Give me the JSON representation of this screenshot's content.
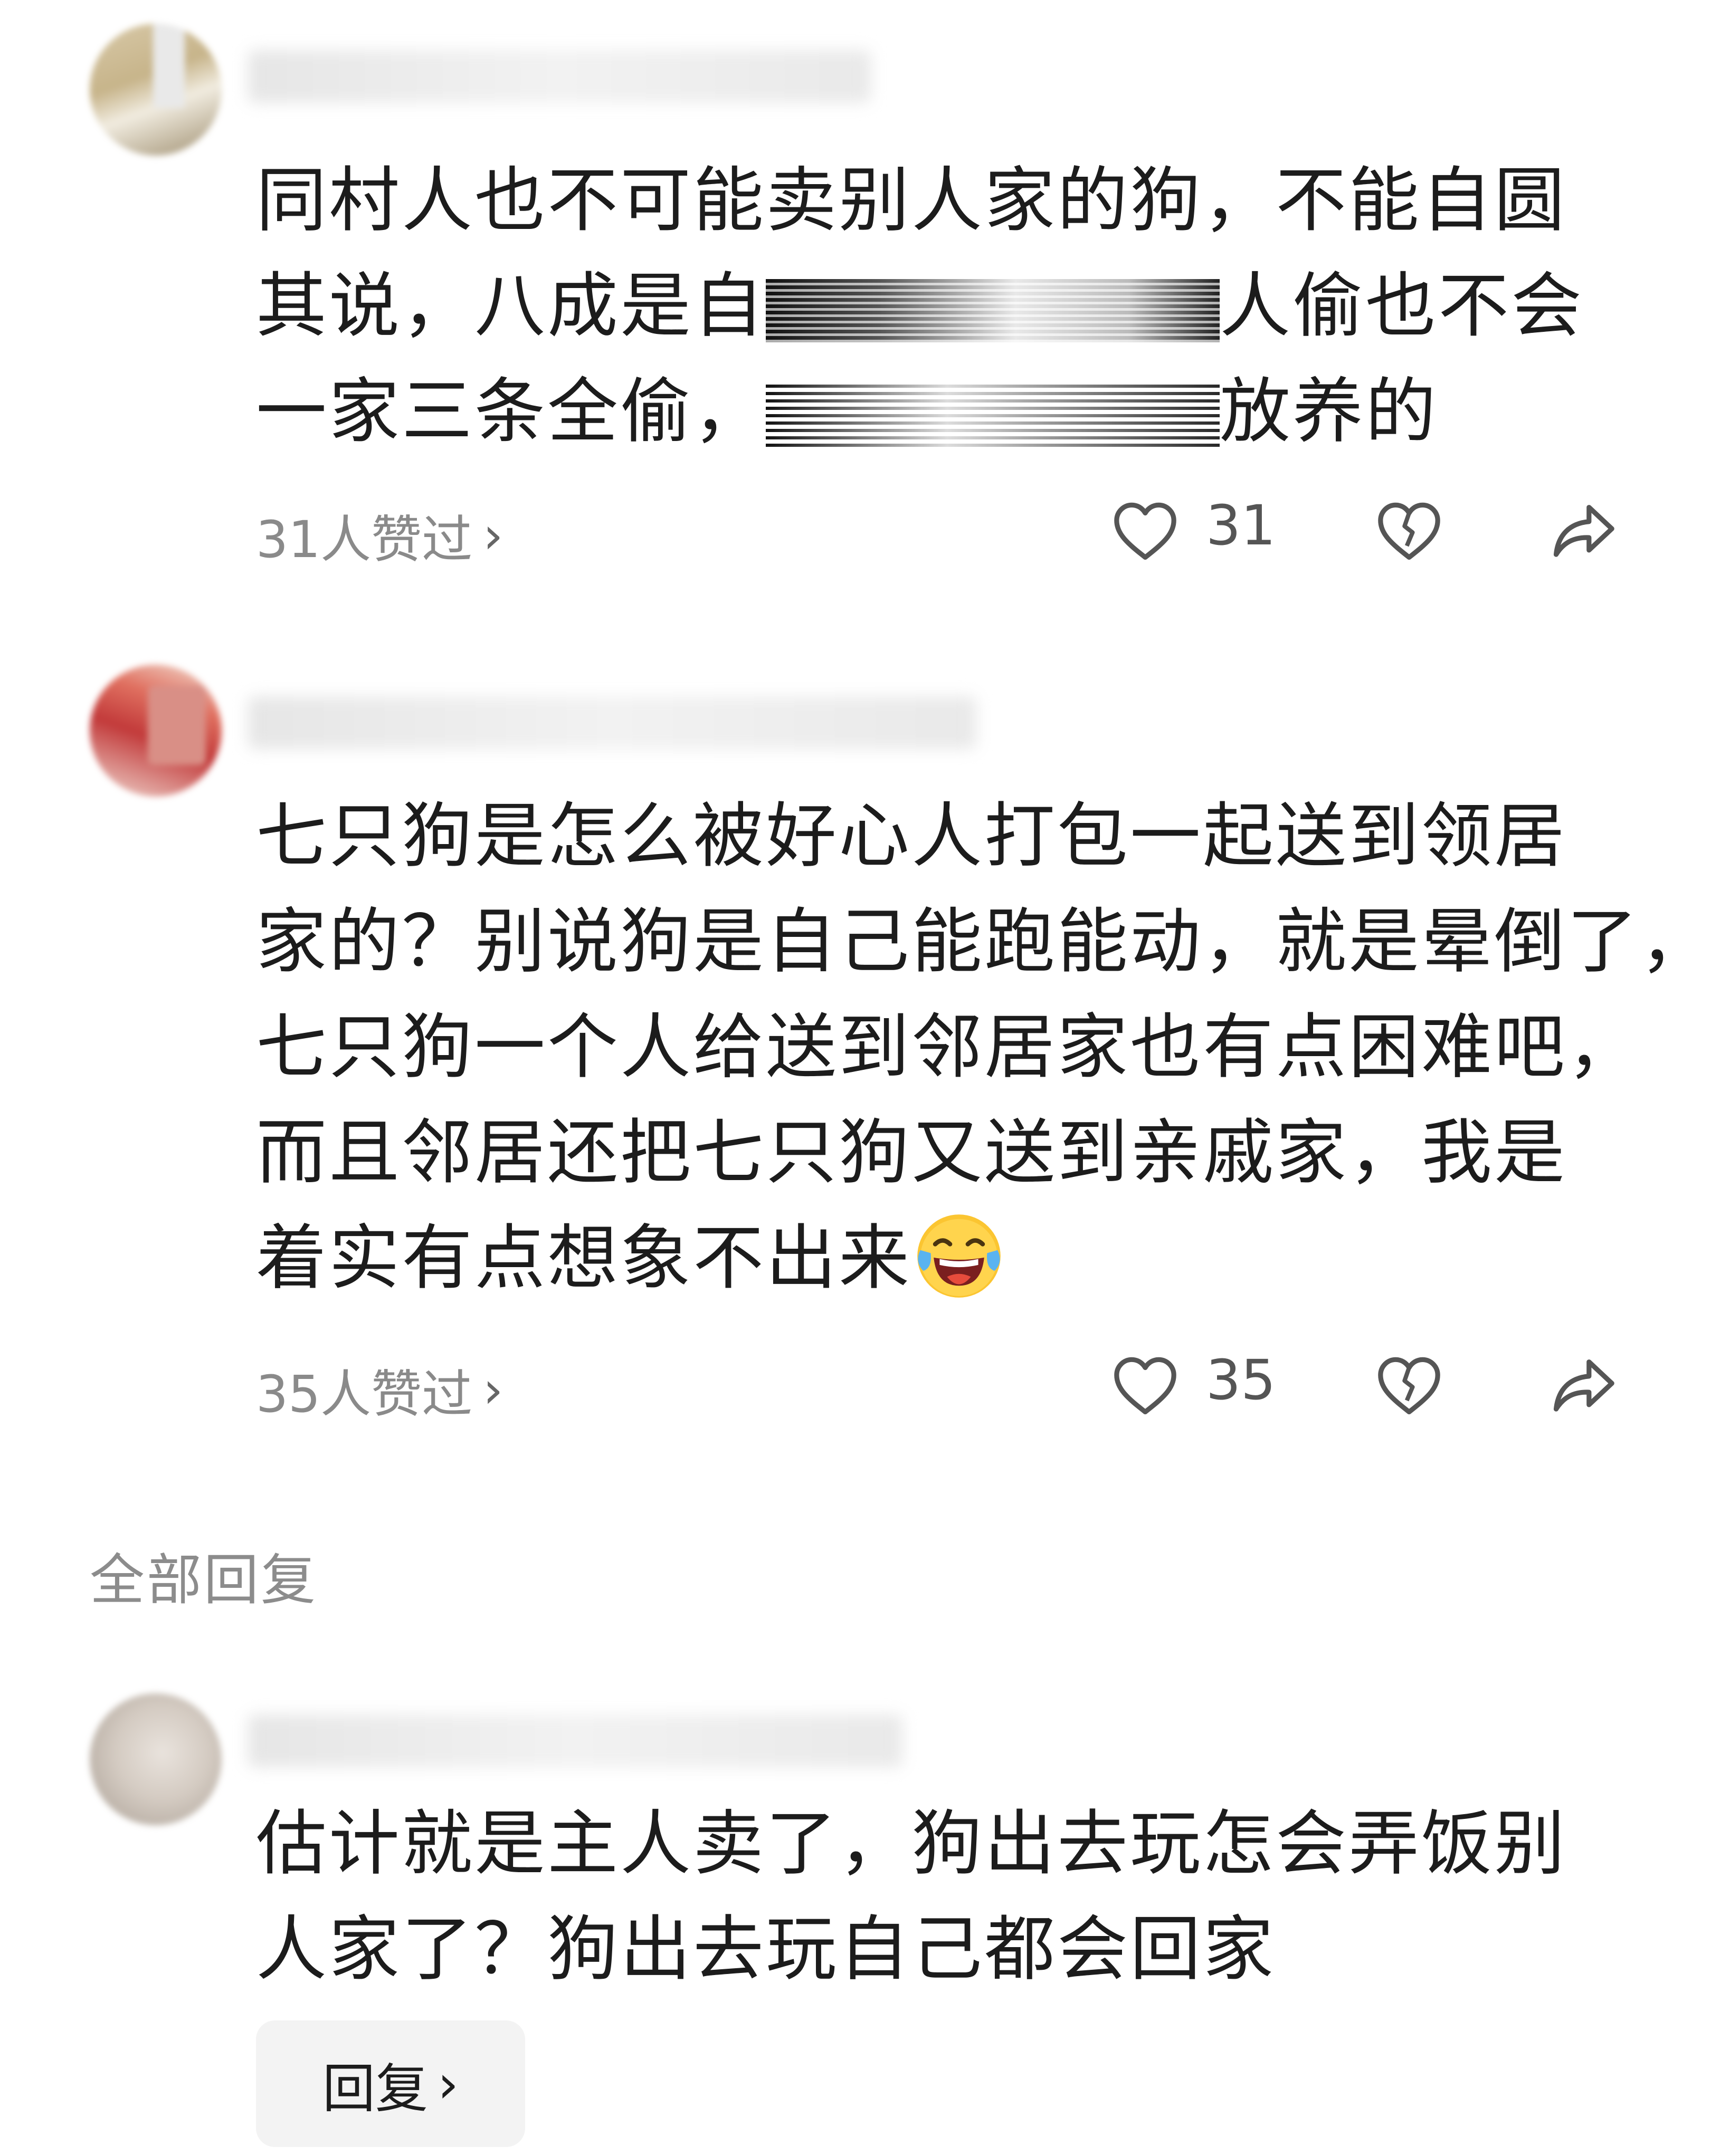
{
  "comments": [
    {
      "lines": [
        {
          "before": "同村人也不可能卖别人家的狗，不能自圆",
          "redacted": false,
          "after": ""
        },
        {
          "before": "其说，八成是自",
          "redacted": true,
          "after": "人偷也不会"
        },
        {
          "before": "一家三条全偷，",
          "redacted": true,
          "after": "放养的"
        }
      ],
      "likes_text": "31人赞过",
      "like_count": "31"
    },
    {
      "lines": [
        {
          "before": "七只狗是怎么被好心人打包一起送到领居",
          "redacted": false,
          "after": ""
        },
        {
          "before": "家的？别说狗是自己能跑能动，就是晕倒了，",
          "redacted": false,
          "after": ""
        },
        {
          "before": "七只狗一个人给送到邻居家也有点困难吧，",
          "redacted": false,
          "after": ""
        },
        {
          "before": "而且邻居还把七只狗又送到亲戚家，我是",
          "redacted": false,
          "after": ""
        },
        {
          "before": "着实有点想象不出来",
          "redacted": false,
          "after": ""
        }
      ],
      "likes_text": "35人赞过",
      "like_count": "35"
    }
  ],
  "section_title": "全部回复",
  "reply_comment": {
    "lines": [
      "估计就是主人卖了，狗出去玩怎会弄饭别",
      "人家了？狗出去玩自己都会回家"
    ],
    "reply_button_label": "回复"
  },
  "icons": {
    "chevron": "›",
    "like": "heart-icon",
    "dislike": "broken-heart-icon",
    "share": "share-arrow-icon",
    "emoji": "laughing-tears-emoji"
  },
  "colors": {
    "text": "#1c1c1c",
    "muted": "#8a8a8a",
    "icon": "#555555",
    "button_bg": "#f3f3f3"
  }
}
